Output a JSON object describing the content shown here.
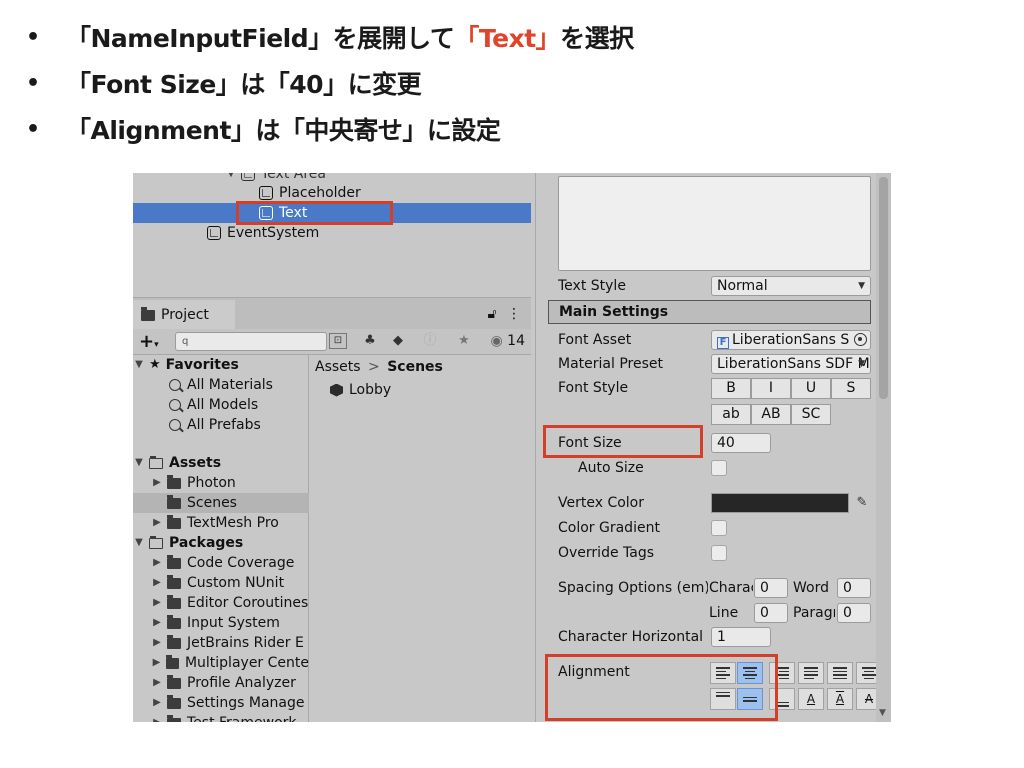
{
  "slide": {
    "bullet_char": "•",
    "bullets": [
      {
        "before": "「NameInputField」を展開して",
        "highlight": "「Text」",
        "after": "を選択"
      },
      {
        "before": "「Font Size」は「40」に変更",
        "highlight": "",
        "after": ""
      },
      {
        "before": "「Alignment」は「中央寄せ」に設定",
        "highlight": "",
        "after": ""
      }
    ],
    "highlight_color": "#e0442a",
    "annotation_color": "#d2402a"
  },
  "hierarchy": {
    "partial_row": "Text Area",
    "rows": [
      "Placeholder",
      "Text",
      "EventSystem"
    ],
    "selected_color": "#4a79c7"
  },
  "project": {
    "tab_label": "Project",
    "search_placeholder": "q",
    "hidden_count": "14",
    "favorites": {
      "label": "Favorites",
      "items": [
        "All Materials",
        "All Models",
        "All Prefabs"
      ]
    },
    "assets": {
      "label": "Assets",
      "items": [
        "Photon",
        "Scenes",
        "TextMesh Pro"
      ]
    },
    "packages": {
      "label": "Packages",
      "items": [
        "Code Coverage",
        "Custom NUnit",
        "Editor Coroutines",
        "Input System",
        "JetBrains Rider E",
        "Multiplayer Cente",
        "Profile Analyzer",
        "Settings Manage",
        "Test Framework"
      ]
    },
    "breadcrumb": {
      "root": "Assets",
      "sep": ">",
      "current": "Scenes"
    },
    "files": [
      "Lobby"
    ]
  },
  "inspector": {
    "text_style_label": "Text Style",
    "text_style_value": "Normal",
    "section_title": "Main Settings",
    "font_asset_label": "Font Asset",
    "font_asset_value": "LiberationSans S",
    "material_preset_label": "Material Preset",
    "material_preset_value": "LiberationSans SDF M",
    "font_style_label": "Font Style",
    "style_buttons_row1": [
      "B",
      "I",
      "U",
      "S"
    ],
    "style_buttons_row2": [
      "ab",
      "AB",
      "SC"
    ],
    "font_size_label": "Font Size",
    "font_size_value": "40",
    "auto_size_label": "Auto Size",
    "vertex_color_label": "Vertex Color",
    "vertex_color_value": "#262626",
    "color_gradient_label": "Color Gradient",
    "override_tags_label": "Override Tags",
    "spacing_label": "Spacing Options (em)",
    "char_label": "Charac",
    "char_value": "0",
    "word_label": "Word",
    "word_value": "0",
    "line_label": "Line",
    "line_value": "0",
    "para_label": "Paragr",
    "para_value": "0",
    "char_horizontal_label": "Character Horizontal",
    "char_horizontal_value": "1",
    "alignment_label": "Alignment",
    "valign_text_glyph": "A"
  }
}
